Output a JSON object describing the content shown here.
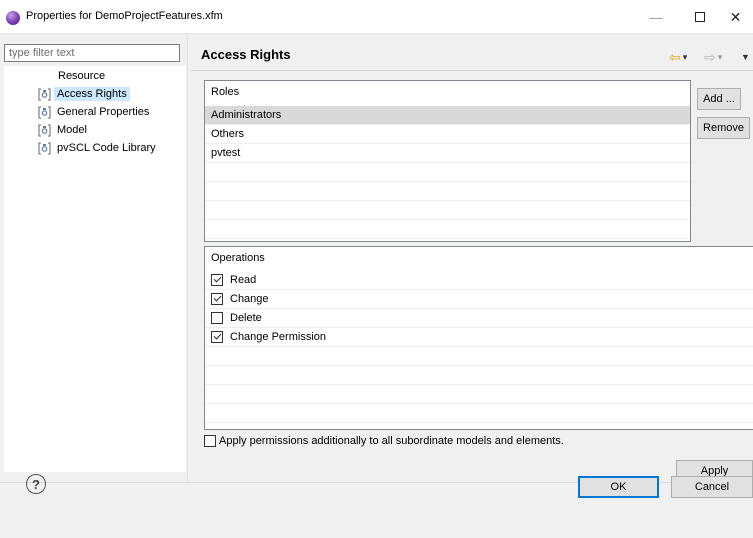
{
  "window": {
    "title": "Properties for DemoProjectFeatures.xfm",
    "minimize": "—",
    "close": "✕"
  },
  "filter": {
    "placeholder": "type filter text",
    "value": ""
  },
  "nav": {
    "items": [
      {
        "label": "Resource",
        "icon": "none"
      },
      {
        "label": "Access Rights",
        "icon": "property-page-icon",
        "selected": true
      },
      {
        "label": "General Properties",
        "icon": "property-page-icon"
      },
      {
        "label": "Model",
        "icon": "property-page-icon"
      },
      {
        "label": "pvSCL Code Library",
        "icon": "property-page-icon"
      }
    ]
  },
  "page": {
    "title": "Access Rights",
    "nav_back": "⇦",
    "nav_forward": "⇨",
    "dropdown": "▾",
    "menu": "▼"
  },
  "roles": {
    "title": "Roles",
    "items": [
      "Administrators",
      "Others",
      "pvtest"
    ],
    "selected_index": 0,
    "add_label": "Add ...",
    "remove_label": "Remove"
  },
  "operations": {
    "title": "Operations",
    "items": [
      {
        "label": "Read",
        "checked": true
      },
      {
        "label": "Change",
        "checked": true
      },
      {
        "label": "Delete",
        "checked": false
      },
      {
        "label": "Change Permission",
        "checked": true
      }
    ]
  },
  "apply_all": {
    "label": "Apply permissions additionally to all subordinate models and elements.",
    "checked": false
  },
  "buttons": {
    "apply": "Apply",
    "ok": "OK",
    "cancel": "Cancel",
    "help": "?"
  },
  "colors": {
    "selection_nav": "#cce8ff",
    "selection_row": "#d9d9d9",
    "default_button_border": "#0078d7",
    "nav_arrow": "#e8a317"
  }
}
